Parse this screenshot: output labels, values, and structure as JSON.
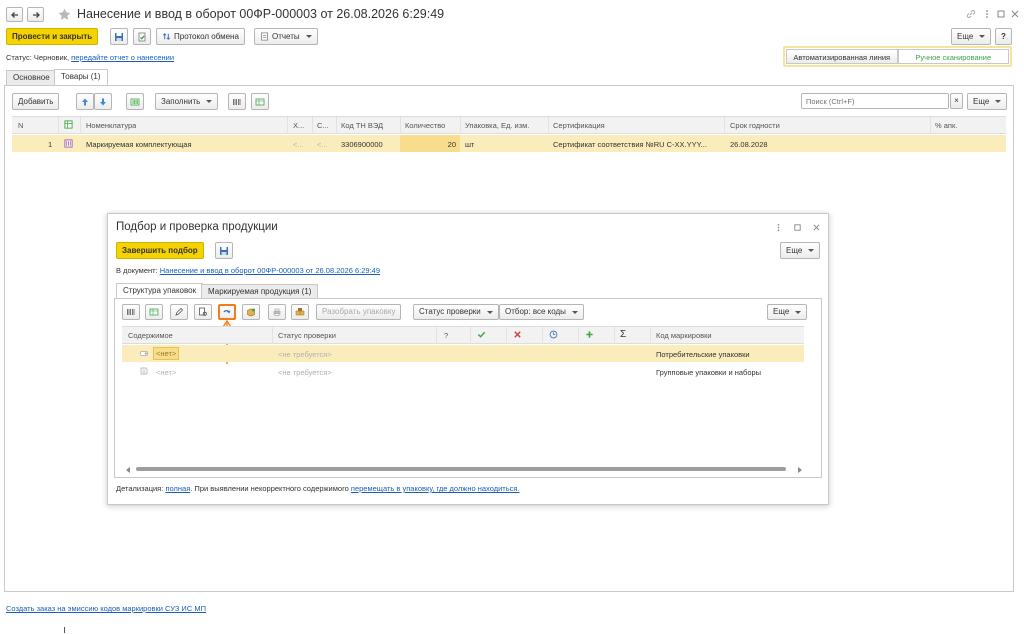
{
  "window": {
    "title": "Нанесение и ввод в оборот 00ФР-000003 от 26.08.2026 6:29:49"
  },
  "toolbar": {
    "post_close": "Провести и закрыть",
    "exchange_log": "Протокол обмена",
    "reports": "Отчеты",
    "more": "Еще",
    "help": "?"
  },
  "status": {
    "prefix": "Статус: Черновик,",
    "link": "передайте отчет о нанесении"
  },
  "mode": {
    "auto": "Автоматизированная линия",
    "manual": "Ручное сканирование"
  },
  "tabs": [
    "Основное",
    "Товары (1)"
  ],
  "goods_toolbar": {
    "add": "Добавить",
    "fill": "Заполнить",
    "search_placeholder": "Поиск (Ctrl+F)",
    "clear": "×",
    "more": "Еще"
  },
  "table": {
    "headers": [
      "N",
      "Номенклатура",
      "Х...",
      "С...",
      "Код ТН ВЭД",
      "Количество",
      "Упаковка, Ед. изм.",
      "Сертификация",
      "Срок годности",
      "% апк."
    ],
    "rows": [
      {
        "n": "1",
        "name": "Маркируемая комплектующая",
        "x": "<...",
        "c": "<...",
        "tnved": "3306900000",
        "qty": "20",
        "unit": "шт",
        "cert": "Сертификат соответствия №RU С-XX.YYY...",
        "expiry": "26.08.2028",
        "pct": ""
      }
    ]
  },
  "bottom_link": "Создать заказ на эмиссию кодов маркировки СУЗ ИС МП",
  "dialog": {
    "title": "Подбор и проверка продукции",
    "finish": "Завершить подбор",
    "more": "Еще",
    "doc_prefix": "В документ:",
    "doc_link": "Нанесение и ввод в оборот 00ФР-000003 от 26.08.2026 6:29:49",
    "tabs": [
      "Структура упаковок",
      "Маркируемая продукция (1)"
    ],
    "unpack": "Разобрать упаковку",
    "check_status": "Статус проверки",
    "filter": "Отбор: все коды",
    "inner_more": "Еще",
    "headers": {
      "content": "Содержимое",
      "status": "Статус проверки",
      "q": "?",
      "sigma": "Σ",
      "code": "Код маркировки"
    },
    "rows": [
      {
        "content": "<нет>",
        "status": "<не требуется>",
        "code": "Потребительские упаковки"
      },
      {
        "content": "<нет>",
        "status": "<не требуется>",
        "code": "Групповые упаковки и наборы"
      }
    ],
    "detail_prefix": "Детализация:",
    "detail_link": "полная",
    "detail_mid": ". При выявлении некорректного содержимого",
    "detail_link2": "перемещать в упаковку, где должно находиться."
  },
  "colors": {
    "accent_yellow": "#f5d300",
    "row_highlight": "#fbedbb",
    "link": "#1a5fb4",
    "highlight_orange": "#f07c1c",
    "green": "#3fa447"
  }
}
